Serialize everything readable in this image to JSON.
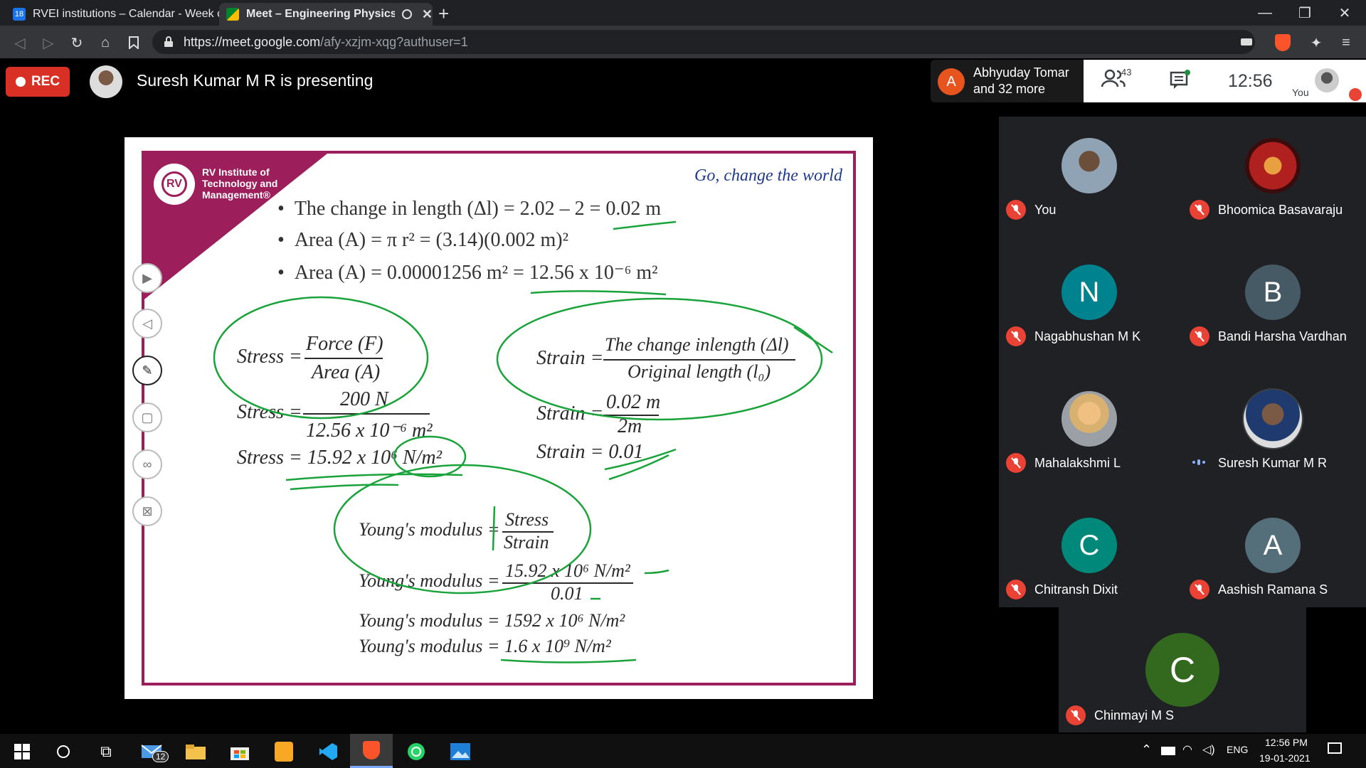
{
  "browser": {
    "tabs": [
      {
        "title": "RVEI institutions – Calendar - Week of",
        "favicon_text": "18",
        "active": false
      },
      {
        "title": "Meet – Engineering Physics A",
        "active": true
      }
    ],
    "url_host": "https://meet.google.com",
    "url_path": "/afy-xzjm-xqg?authuser=1",
    "new_tab_label": "+"
  },
  "meet": {
    "rec_label": "REC",
    "presenting_text": "Suresh Kumar M R is presenting",
    "raised": {
      "initial": "A",
      "line1": "Abhyuday Tomar",
      "line2": "and 32 more"
    },
    "participant_count": "43",
    "time": "12:56",
    "self_label": "You"
  },
  "slide": {
    "institute_name": [
      "RV Institute of",
      "Technology and",
      "Management®"
    ],
    "logo_text": "RV",
    "tagline": "Go, change the world",
    "bullets": [
      "The change in length (Δl) = 2.02 – 2 = 0.02 m",
      "Area (A) = π r² = (3.14)(0.002 m)²",
      "Area (A) = 0.00001256 m² = 12.56 x 10⁻⁶ m²"
    ],
    "stress_label": "Stress =",
    "stress_num": "Force (F)",
    "stress_den": "Area (A)",
    "stress2_num": "200 N",
    "stress2_den": "12.56 x 10⁻⁶ m²",
    "stress3": "Stress = 15.92 x 10⁶ N/m²",
    "strain_label": "Strain =",
    "strain_num": "The change inlength (Δl)",
    "strain_den": "Original length (l₀)",
    "strain2_num": "0.02 m",
    "strain2_den": "2m",
    "strain3": "Strain = 0.01",
    "young_label": "Young's modulus =",
    "young_num": "Stress",
    "young_den": "Strain",
    "young2_num": "15.92 x 10⁶ N/m²",
    "young2_den": "0.01",
    "young3": "Young's modulus = 1592 x 10⁶ N/m²",
    "young4": "Young's modulus = 1.6 x 10⁹ N/m²"
  },
  "participants": [
    {
      "name": "You",
      "kind": "photo",
      "muted": true
    },
    {
      "name": "Bhoomica Basavaraju",
      "kind": "photo",
      "muted": true
    },
    {
      "name": "Nagabhushan M K",
      "initial": "N",
      "color": "#00838f",
      "muted": true
    },
    {
      "name": "Bandi Harsha Vardhan",
      "initial": "B",
      "color": "#455a64",
      "muted": true
    },
    {
      "name": "Mahalakshmi L",
      "kind": "photo",
      "muted": true
    },
    {
      "name": "Suresh Kumar M R",
      "kind": "photo",
      "muted": false
    },
    {
      "name": "Chitransh Dixit",
      "initial": "C",
      "color": "#00897b",
      "muted": true
    },
    {
      "name": "Aashish Ramana S",
      "initial": "A",
      "color": "#546e7a",
      "muted": true
    },
    {
      "name": "Chinmayi M S",
      "initial": "C",
      "color": "#33691e",
      "muted": true
    }
  ],
  "taskbar": {
    "mail_badge": "12",
    "lang": "ENG",
    "time": "12:56 PM",
    "date": "19-01-2021"
  },
  "colors": {
    "accent": "#9c1f5b",
    "rec": "#d93025",
    "mic_off": "#ea4335",
    "pen": "#1aa33a"
  }
}
